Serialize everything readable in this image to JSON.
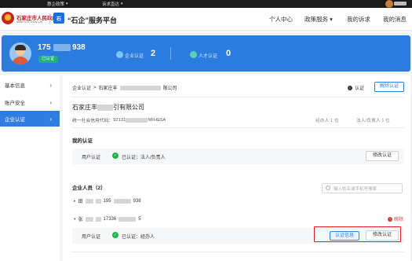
{
  "topbar": {
    "items": [
      {
        "label": "惠企政策"
      },
      {
        "label": "诉求直达"
      }
    ]
  },
  "header": {
    "gov_title": "石家庄市人民政府",
    "gov_url": "www.SJZ.GOV.CN",
    "logo_text": "石",
    "platform_title": "“石企”服务平台",
    "nav": [
      {
        "label": "个人中心"
      },
      {
        "label": "政策服务 ▾"
      },
      {
        "label": "我的诉求"
      },
      {
        "label": "我的消息"
      }
    ]
  },
  "profile": {
    "phone_prefix": "175",
    "phone_suffix": "938",
    "verified_label": "已认证",
    "stats": [
      {
        "label": "企业认证",
        "count": "2",
        "color": "#7cc5f5"
      },
      {
        "label": "人才认证",
        "count": "0",
        "color": "#5ad1b0"
      }
    ]
  },
  "sidebar": {
    "items": [
      {
        "label": "基本信息"
      },
      {
        "label": "账户安全"
      },
      {
        "label": "企业认证"
      }
    ]
  },
  "main": {
    "breadcrumb_root": "企业认证",
    "breadcrumb_sep": ">",
    "breadcrumb_prefix": "石家庄丰",
    "breadcrumb_suffix": "限公司",
    "status_label": "认证",
    "unbind_button": "解除认证",
    "company_prefix": "石家庄丰",
    "company_suffix": "引有限公司",
    "credit_label": "统一社会信用代码：",
    "credit_prefix": "92131",
    "credit_suffix": "NFHE5A",
    "operator_count": "经办人 1 位",
    "legal_count": "法人/负责人 1 位",
    "my_auth_title": "我的认证",
    "my_auth_row": {
      "label": "用户认证",
      "status": "已认证：法人/负责人",
      "button": "修改认证"
    },
    "staff_title": "企业人员（2）",
    "search_placeholder": "输入姓名或手机号搜索",
    "staff": [
      {
        "name_prefix": "田",
        "phone_prefix": "195",
        "phone_suffix": "938"
      },
      {
        "name_prefix": "张",
        "phone_prefix": "17336",
        "phone_suffix": "5"
      }
    ],
    "remove_label": "移除",
    "staff_auth_row": {
      "label": "用户认证",
      "status": "已认证：经办人",
      "info_button": "认证信息",
      "edit_button": "修改认证"
    }
  }
}
